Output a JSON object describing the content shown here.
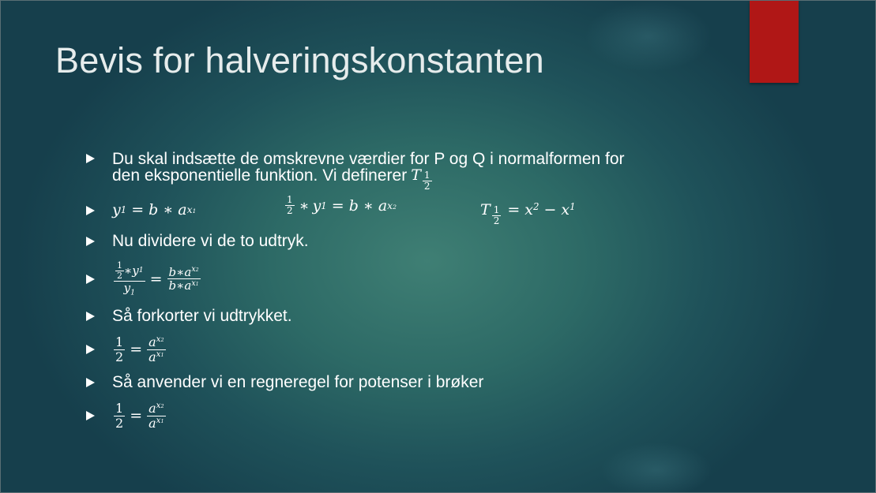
{
  "slide": {
    "title": "Bevis for halveringskonstanten",
    "accent_color": "#b01716",
    "bullets": {
      "b1_line1": "Du skal indsætte de omskrevne værdier for P og Q i normalformen for",
      "b1_line2": "den eksponentielle funktion. Vi definerer",
      "b3": "Nu dividere vi de to udtryk.",
      "b5": "Så forkorter vi udtrykket.",
      "b7": "Så anvender vi en regneregel for potenser i brøker"
    },
    "math": {
      "T": "T",
      "y": "y",
      "b": "b",
      "a": "a",
      "x": "x",
      "one": "1",
      "two": "2",
      "eq": "=",
      "times": "∗",
      "minus": "−"
    }
  }
}
